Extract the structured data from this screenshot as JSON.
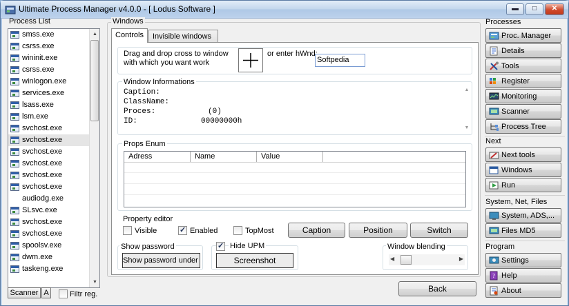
{
  "window": {
    "title": "Ultimate Process Manager v4.0.0 - [ Lodus Software ]"
  },
  "process_list": {
    "label": "Process List",
    "items": [
      "smss.exe",
      "csrss.exe",
      "wininit.exe",
      "csrss.exe",
      "winlogon.exe",
      "services.exe",
      "lsass.exe",
      "lsm.exe",
      "svchost.exe",
      "svchost.exe",
      "svchost.exe",
      "svchost.exe",
      "svchost.exe",
      "svchost.exe",
      "audiodg.exe",
      "SLsvc.exe",
      "svchost.exe",
      "svchost.exe",
      "spoolsv.exe",
      "dwm.exe",
      "taskeng.exe"
    ],
    "scanner_label": "Scanner",
    "a_label": "A",
    "filter_label": "Filtr reg."
  },
  "windows": {
    "label": "Windows",
    "tabs": [
      "Controls",
      "Invisible windows"
    ],
    "drag_text_1": "Drag and drop cross to window",
    "drag_text_2": "with which you want work",
    "or_enter": "or enter hWnd:",
    "hwnd_value": "Softpedia",
    "info": {
      "title": "Window Informations",
      "caption_label": "Caption:",
      "classname_label": "ClassName:",
      "proces_label": "Proces:",
      "proces_value": "(0)",
      "id_label": "ID:",
      "id_value": "00000000h"
    },
    "props": {
      "title": "Props Enum",
      "columns": [
        "Adress",
        "Name",
        "Value"
      ]
    },
    "editor": {
      "title": "Property editor",
      "visible": "Visible",
      "enabled": "Enabled",
      "topmost": "TopMost",
      "caption_btn": "Caption",
      "position_btn": "Position",
      "switch_btn": "Switch"
    },
    "show_password": {
      "title": "Show password",
      "button": "Show password under *"
    },
    "hide_upm": "Hide UPM",
    "screenshot": "Screenshot",
    "blending": "Window blending",
    "back": "Back"
  },
  "right": {
    "processes": "Processes",
    "proc_manager": "Proc. Manager",
    "details": "Details",
    "tools": "Tools",
    "register": "Register",
    "monitoring": "Monitoring",
    "scanner": "Scanner",
    "process_tree": "Process Tree",
    "next": "Next",
    "next_tools": "Next tools",
    "windows": "Windows",
    "run": "Run",
    "system_net_files": "System, Net, Files",
    "system_ads": "System, ADS,...",
    "files_md5": "Files MD5",
    "program": "Program",
    "settings": "Settings",
    "help": "Help",
    "about": "About"
  }
}
